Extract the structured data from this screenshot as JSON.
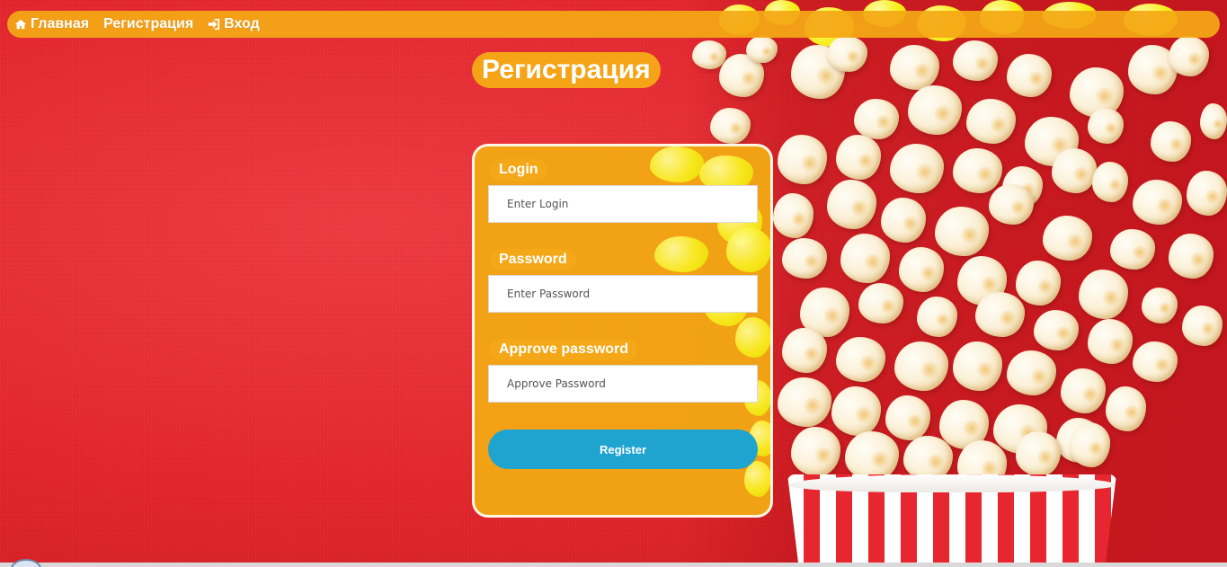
{
  "navbar": {
    "items": [
      {
        "label": "Главная",
        "icon": "home-icon"
      },
      {
        "label": "Регистрация",
        "icon": ""
      },
      {
        "label": "Вход",
        "icon": "sign-in-icon"
      }
    ]
  },
  "page_title": "Регистрация",
  "form": {
    "login": {
      "label": "Login",
      "placeholder": "Enter Login",
      "value": ""
    },
    "password": {
      "label": "Password",
      "placeholder": "Enter Password",
      "value": ""
    },
    "approve": {
      "label": "Approve password",
      "placeholder": "Approve Password",
      "value": ""
    },
    "submit_label": "Register"
  },
  "colors": {
    "background": "#e2262d",
    "accent": "#f4a416",
    "button": "#1fa3cf",
    "text": "#ffffff"
  },
  "background_image": "popcorn-bucket-image"
}
